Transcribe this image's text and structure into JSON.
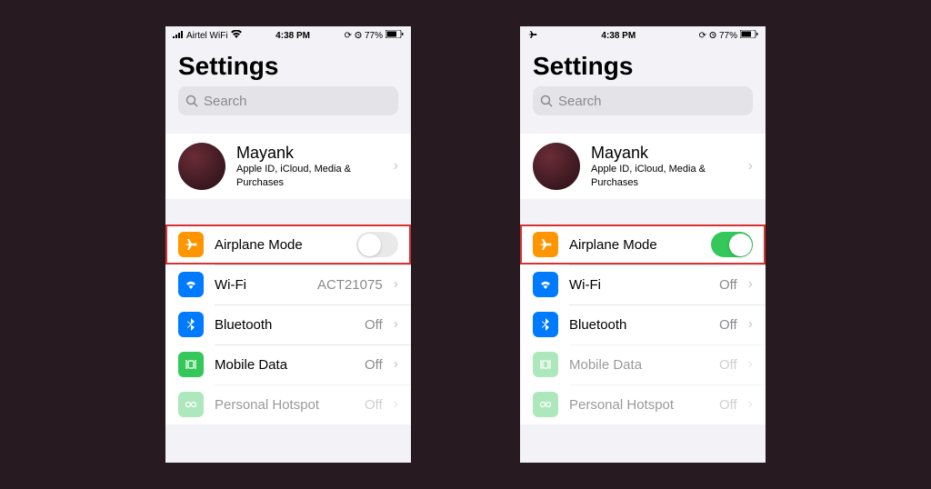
{
  "screens": [
    {
      "statusbar": {
        "carrier": "Airtel WiFi",
        "time": "4:38 PM",
        "battery": "77%",
        "airplane_mode_on": false
      },
      "title": "Settings",
      "search_placeholder": "Search",
      "profile": {
        "name": "Mayank",
        "subtitle": "Apple ID, iCloud, Media & Purchases"
      },
      "rows": [
        {
          "icon": "airplane-icon",
          "label": "Airplane Mode",
          "toggle": false,
          "highlight": true,
          "color": "#ff9500"
        },
        {
          "icon": "wifi-icon",
          "label": "Wi-Fi",
          "value": "ACT21075",
          "color": "#007aff"
        },
        {
          "icon": "bluetooth-icon",
          "label": "Bluetooth",
          "value": "Off",
          "color": "#007aff"
        },
        {
          "icon": "cellular-icon",
          "label": "Mobile Data",
          "value": "Off",
          "color": "#34c759"
        },
        {
          "icon": "hotspot-icon",
          "label": "Personal Hotspot",
          "value": "Off",
          "color": "#34c759",
          "disabled": true
        }
      ]
    },
    {
      "statusbar": {
        "carrier": "",
        "time": "4:38 PM",
        "battery": "77%",
        "airplane_mode_on": true
      },
      "title": "Settings",
      "search_placeholder": "Search",
      "profile": {
        "name": "Mayank",
        "subtitle": "Apple ID, iCloud, Media & Purchases"
      },
      "rows": [
        {
          "icon": "airplane-icon",
          "label": "Airplane Mode",
          "toggle": true,
          "highlight": true,
          "color": "#ff9500"
        },
        {
          "icon": "wifi-icon",
          "label": "Wi-Fi",
          "value": "Off",
          "color": "#007aff"
        },
        {
          "icon": "bluetooth-icon",
          "label": "Bluetooth",
          "value": "Off",
          "color": "#007aff"
        },
        {
          "icon": "cellular-icon",
          "label": "Mobile Data",
          "value": "Off",
          "color": "#34c759",
          "disabled": true
        },
        {
          "icon": "hotspot-icon",
          "label": "Personal Hotspot",
          "value": "Off",
          "color": "#34c759",
          "disabled": true
        }
      ]
    }
  ]
}
